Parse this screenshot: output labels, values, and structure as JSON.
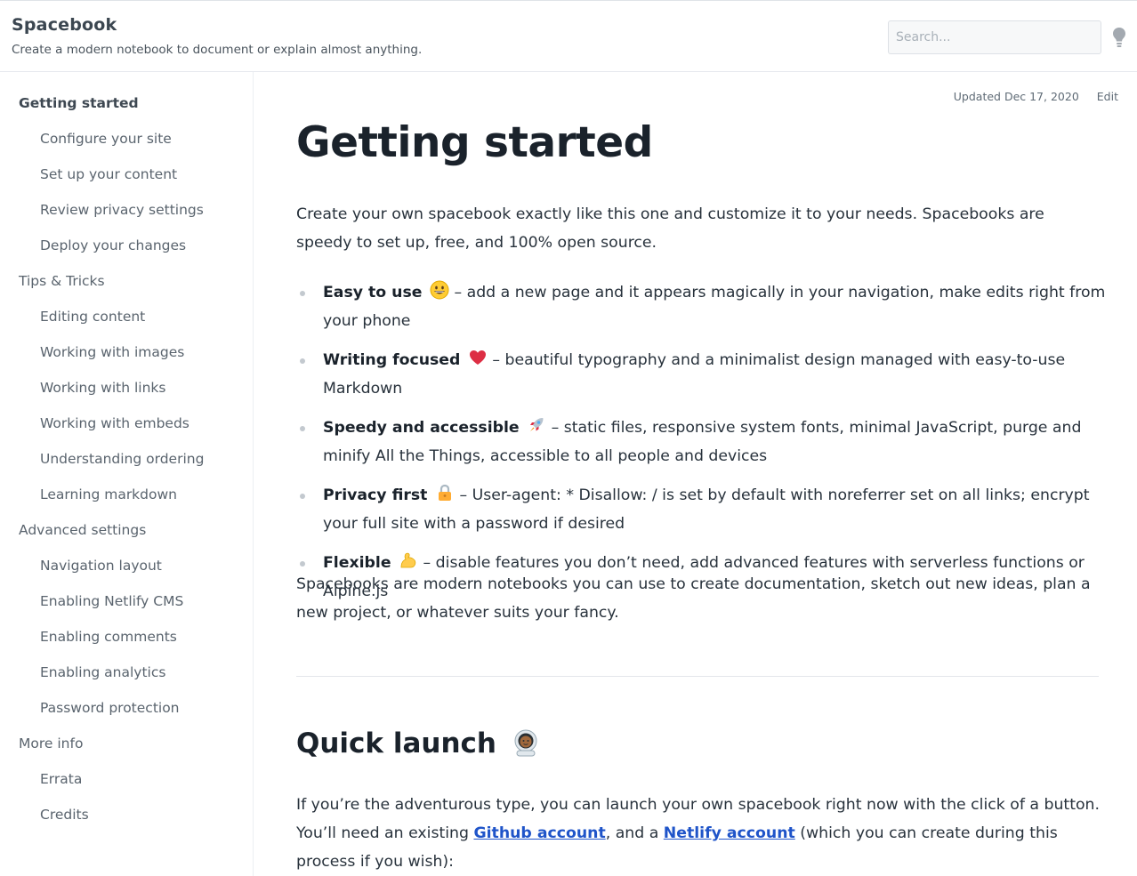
{
  "site": {
    "title": "Spacebook",
    "tagline": "Create a modern notebook to document or explain almost anything.",
    "search_placeholder": "Search..."
  },
  "sidebar": [
    {
      "label": "Getting started",
      "level": 0,
      "active": true
    },
    {
      "label": "Configure your site",
      "level": 1
    },
    {
      "label": "Set up your content",
      "level": 1
    },
    {
      "label": "Review privacy settings",
      "level": 1
    },
    {
      "label": "Deploy your changes",
      "level": 1
    },
    {
      "label": "Tips & Tricks",
      "level": 0
    },
    {
      "label": "Editing content",
      "level": 1
    },
    {
      "label": "Working with images",
      "level": 1
    },
    {
      "label": "Working with links",
      "level": 1
    },
    {
      "label": "Working with embeds",
      "level": 1
    },
    {
      "label": "Understanding ordering",
      "level": 1
    },
    {
      "label": "Learning markdown",
      "level": 1
    },
    {
      "label": "Advanced settings",
      "level": 0
    },
    {
      "label": "Navigation layout",
      "level": 1
    },
    {
      "label": "Enabling Netlify CMS",
      "level": 1
    },
    {
      "label": "Enabling comments",
      "level": 1
    },
    {
      "label": "Enabling analytics",
      "level": 1
    },
    {
      "label": "Password protection",
      "level": 1
    },
    {
      "label": "More info",
      "level": 0
    },
    {
      "label": "Errata",
      "level": 1
    },
    {
      "label": "Credits",
      "level": 1
    }
  ],
  "page": {
    "updated": "Updated Dec 17, 2020",
    "edit_label": "Edit",
    "title": "Getting started",
    "intro": "Create your own spacebook exactly like this one and customize it to your needs. Spacebooks are speedy to set up, free, and 100% open source.",
    "features": [
      {
        "title": "Easy to use",
        "emoji": "grinning-face",
        "text": " – add a new page and it appears magically in your navigation, make edits right from your phone"
      },
      {
        "title": "Writing focused",
        "emoji": "red-heart",
        "text": " – beautiful typography and a minimalist design managed with easy-to-use Markdown"
      },
      {
        "title": "Speedy and accessible",
        "emoji": "rocket",
        "text": " – static files, responsive system fonts, minimal JavaScript, purge and minify All the Things, accessible to all people and devices"
      },
      {
        "title": "Privacy first",
        "emoji": "lock",
        "text": " – User-agent: * Disallow: / is set by default with noreferrer set on all links; encrypt your full site with a password if desired"
      },
      {
        "title": "Flexible",
        "emoji": "flexed-biceps",
        "text": " – disable features you don’t need, add advanced features with serverless functions or Alpine.js"
      }
    ],
    "summary": "Spacebooks are modern notebooks you can use to create documentation, sketch out new ideas, plan a new project, or whatever suits your fancy.",
    "quick_launch": {
      "title": "Quick launch",
      "emoji": "astronaut",
      "text_before": "If you’re the adventurous type, you can launch your own spacebook right now with the click of a button. You’ll need an existing ",
      "link1": "Github account",
      "text_middle": ", and a ",
      "link2": "Netlify account",
      "text_after": " (which you can create during this process if you wish):"
    }
  }
}
